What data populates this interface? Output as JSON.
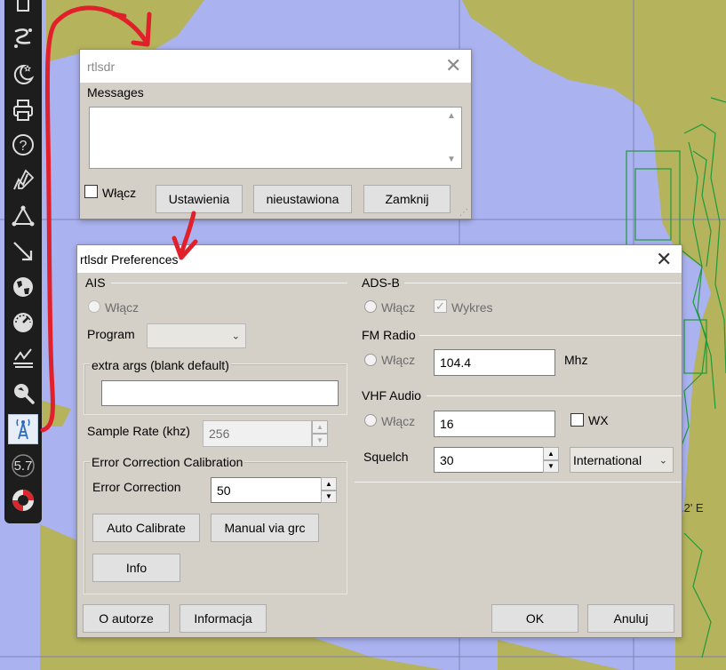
{
  "map": {
    "coordinate_label": ".2' E"
  },
  "toolbar": {
    "items": [
      "page-icon",
      "route-icon",
      "night-mode-icon",
      "print-icon",
      "help-icon",
      "draw-icon",
      "tracks-icon",
      "measure-icon",
      "globe-icon",
      "dashboard-icon",
      "chart-icon",
      "search-icon",
      "radio-tower-icon"
    ],
    "zoom_label": "5.7",
    "bottom_icon": "lifebuoy-icon"
  },
  "rtlsdr_window": {
    "title": "rtlsdr",
    "messages_label": "Messages",
    "messages_text": "",
    "enable_label": "Włącz",
    "settings_button": "Ustawienia",
    "status_button": "nieustawiona",
    "close_button": "Zamknij"
  },
  "prefs_window": {
    "title": "rtlsdr Preferences",
    "ais": {
      "header": "AIS",
      "enable_label": "Włącz",
      "program_label": "Program",
      "program_value": "",
      "extra_args_label": "extra args (blank default)",
      "extra_args_value": "",
      "sample_rate_label": "Sample Rate (khz)",
      "sample_rate_value": "256",
      "ecc_header": "Error Correction Calibration",
      "error_correction_label": "Error Correction",
      "error_correction_value": "50",
      "auto_calibrate_button": "Auto Calibrate",
      "manual_button": "Manual via grc",
      "info_button": "Info"
    },
    "adsb": {
      "header": "ADS-B",
      "enable_label": "Włącz",
      "plot_label": "Wykres",
      "plot_checked": true
    },
    "fm": {
      "header": "FM Radio",
      "enable_label": "Włącz",
      "frequency_value": "104.4",
      "unit_label": "Mhz"
    },
    "vhf": {
      "header": "VHF Audio",
      "enable_label": "Włącz",
      "channel_value": "16",
      "wx_label": "WX",
      "squelch_label": "Squelch",
      "squelch_value": "30",
      "region_value": "International"
    },
    "footer": {
      "about_button": "O autorze",
      "info_button": "Informacja",
      "ok_button": "OK",
      "cancel_button": "Anuluj"
    }
  },
  "colors": {
    "sea": "#aab2f0",
    "land": "#b5b35c",
    "grid": "#7f82b8",
    "chart_lines": "#1f9a3a",
    "annotation": "#e0202a",
    "dialog_bg": "#d4d0c8"
  }
}
